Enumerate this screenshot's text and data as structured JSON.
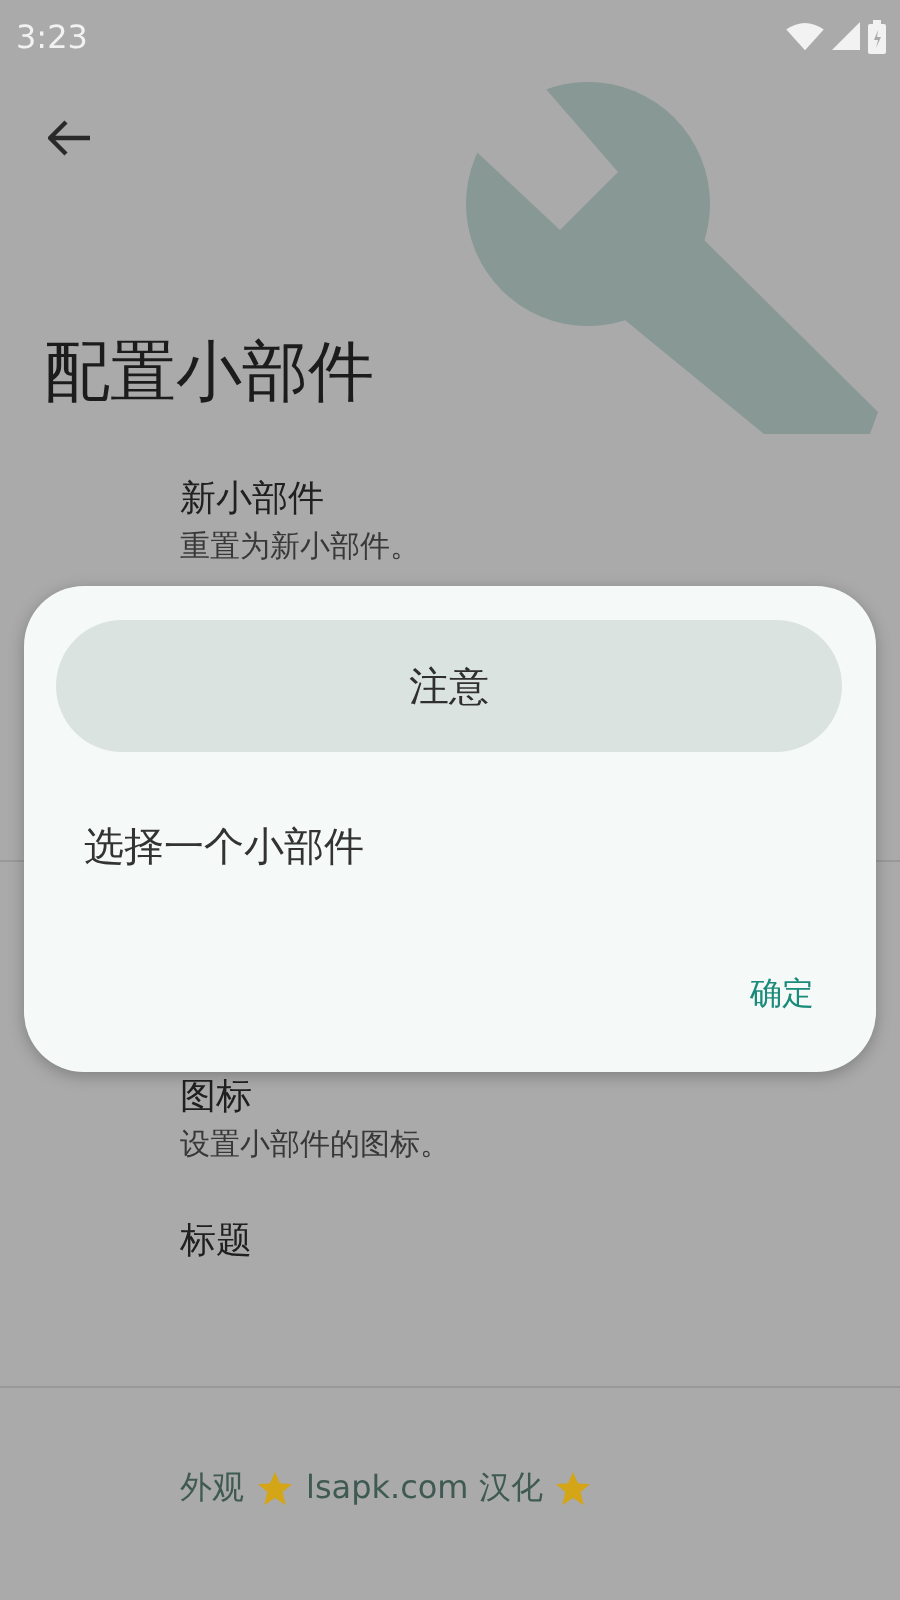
{
  "status_bar": {
    "time": "3:23"
  },
  "toolbar": {
    "title": "配置小部件"
  },
  "preferences": [
    {
      "kind": "item",
      "title": "新小部件",
      "summary": "重置为新小部件。"
    },
    {
      "kind": "divider"
    },
    {
      "kind": "item",
      "title": "图标",
      "summary": "设置小部件的图标。"
    },
    {
      "kind": "item",
      "title": "标题"
    },
    {
      "kind": "divider"
    },
    {
      "kind": "category",
      "parts": [
        {
          "kind": "text",
          "text": "外观"
        },
        {
          "kind": "star"
        },
        {
          "kind": "text",
          "text": "lsapk.com 汉化"
        },
        {
          "kind": "star"
        }
      ]
    }
  ],
  "dialog": {
    "title": "注意",
    "message": "选择一个小部件",
    "buttons": [
      "确定"
    ]
  }
}
